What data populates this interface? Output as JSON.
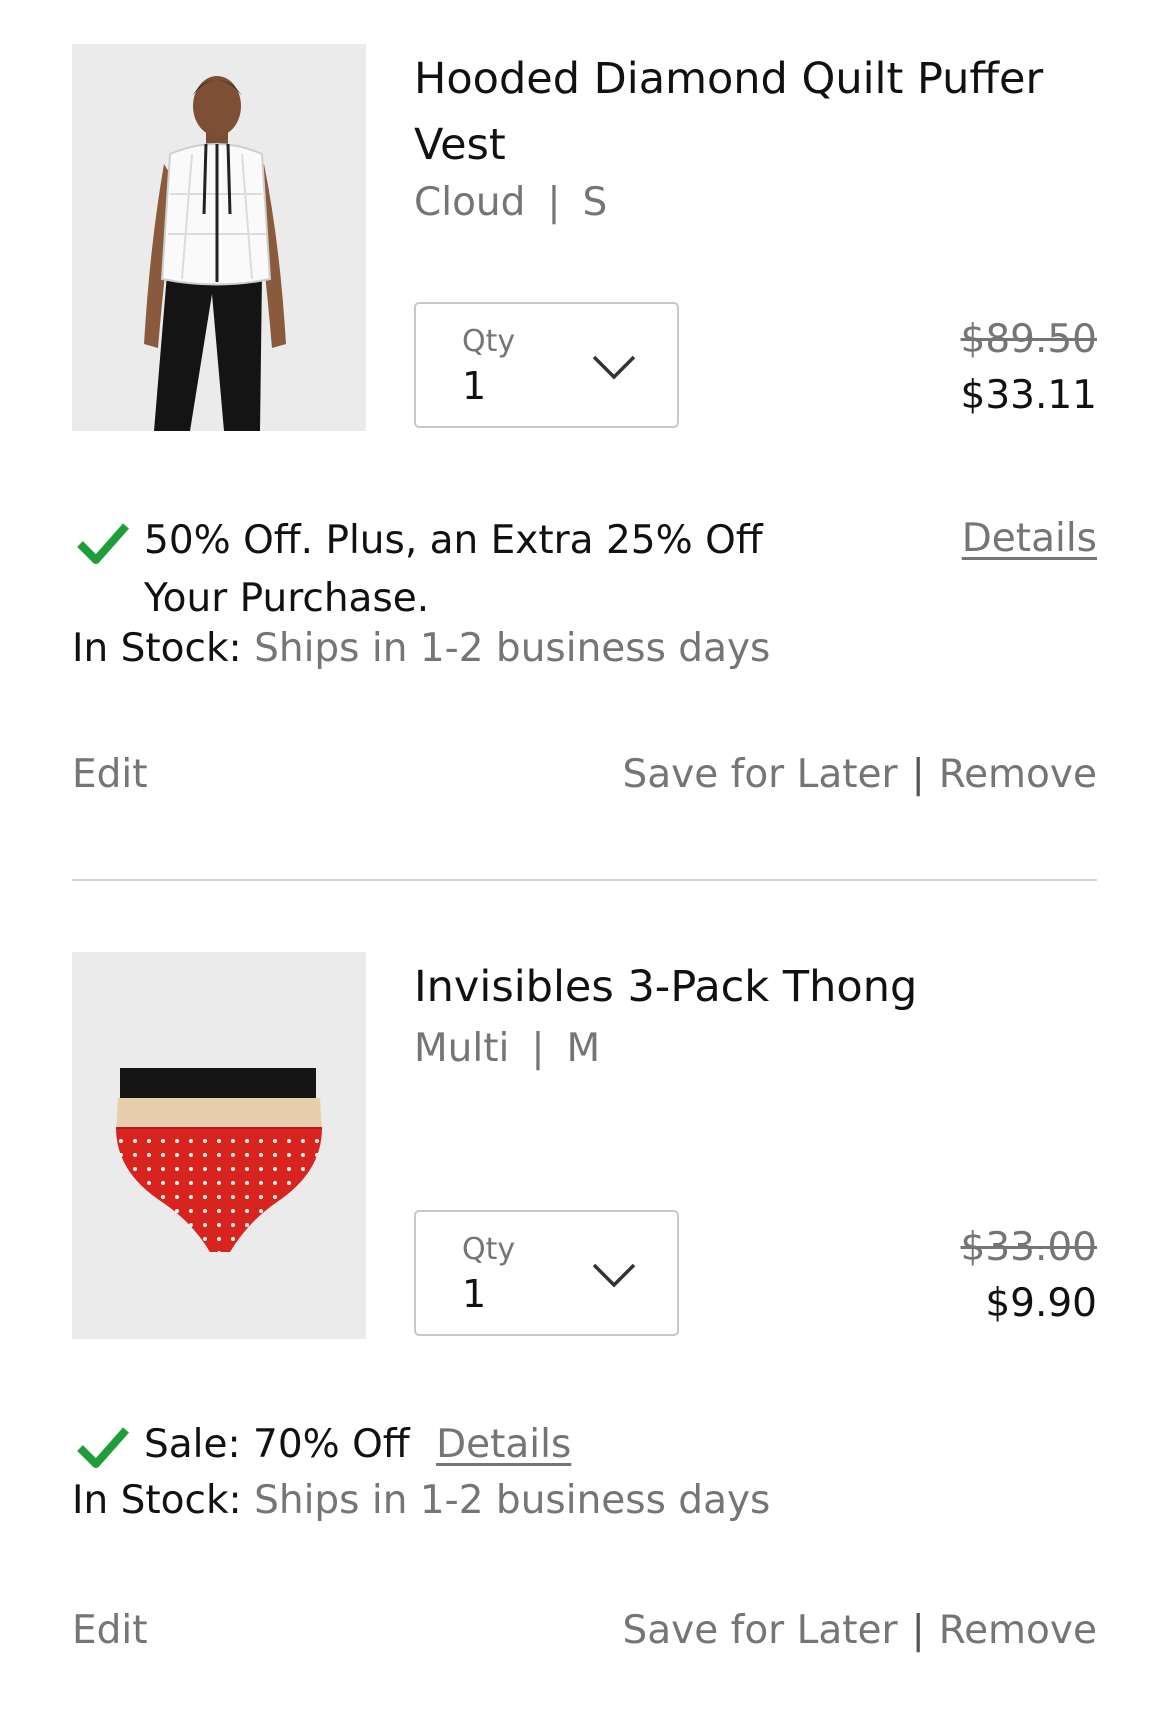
{
  "items": [
    {
      "title": "Hooded Diamond Quilt Puffer Vest",
      "color": "Cloud",
      "size": "S",
      "variant_separator": "|",
      "qty_label": "Qty",
      "qty_value": "1",
      "price_original": "$89.50",
      "price_sale": "$33.11",
      "promo_text": "50% Off. Plus, an Extra 25% Off Your Purchase.",
      "details_label": "Details",
      "stock_label": "In Stock:",
      "ship_text": "Ships in 1-2 business days",
      "edit_label": "Edit",
      "save_for_later_label": "Save for Later",
      "action_separator": "|",
      "remove_label": "Remove"
    },
    {
      "title": "Invisibles 3-Pack Thong",
      "color": "Multi",
      "size": "M",
      "variant_separator": "|",
      "qty_label": "Qty",
      "qty_value": "1",
      "price_original": "$33.00",
      "price_sale": "$9.90",
      "promo_text": "Sale: 70% Off",
      "details_label": "Details",
      "stock_label": "In Stock:",
      "ship_text": "Ships in 1-2 business days",
      "edit_label": "Edit",
      "save_for_later_label": "Save for Later",
      "action_separator": "|",
      "remove_label": "Remove"
    }
  ],
  "colors": {
    "check_green": "#1e9e3a",
    "muted_text": "#757575",
    "divider": "#d4d4d4"
  }
}
